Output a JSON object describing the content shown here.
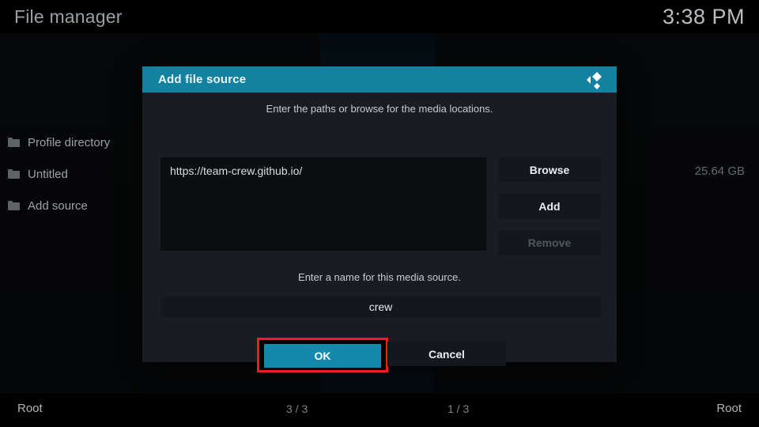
{
  "header": {
    "app_title": "File manager",
    "clock": "3:38 PM"
  },
  "sidebar": {
    "items": [
      {
        "label": "Profile directory",
        "icon": "folder-icon"
      },
      {
        "label": "Untitled",
        "icon": "folder-icon"
      },
      {
        "label": "Add source",
        "icon": "folder-icon"
      }
    ]
  },
  "right_pane": {
    "disk_size": "25.64 GB"
  },
  "status_bar": {
    "left_path": "Root",
    "left_count": "3 / 3",
    "right_count": "1 / 3",
    "right_path": "Root"
  },
  "dialog": {
    "title": "Add file source",
    "logo": "kodi-logo",
    "hint_paths": "Enter the paths or browse for the media locations.",
    "paths": [
      "https://team-crew.github.io/"
    ],
    "buttons": {
      "browse": "Browse",
      "add": "Add",
      "remove": "Remove"
    },
    "hint_name": "Enter a name for this media source.",
    "name_value": "crew",
    "ok": "OK",
    "cancel": "Cancel"
  },
  "colors": {
    "accent": "#13819f",
    "ok_button": "#1589ab",
    "highlight": "#f01d1d",
    "dialog_bg": "#191d22",
    "field_bg": "#0b0e11"
  }
}
